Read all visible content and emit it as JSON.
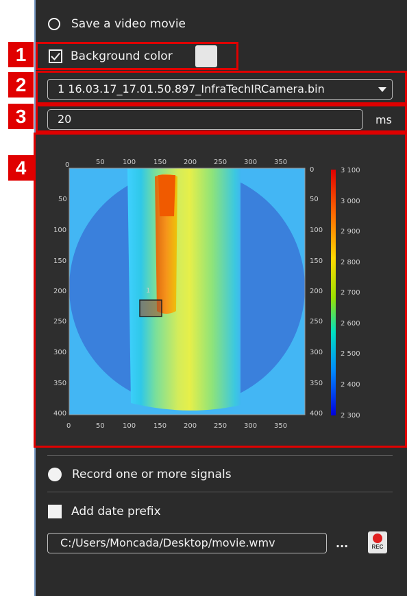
{
  "options": {
    "save_video_label": "Save a video movie",
    "background_color_label": "Background color",
    "file_dropdown_value": "1 16.03.17_17.01.50.897_InfraTechIRCamera.bin",
    "interval_value": "20",
    "interval_unit": "ms",
    "record_signals_label": "Record one or more signals",
    "add_date_prefix_label": "Add date prefix",
    "output_path": "C:/Users/Moncada/Desktop/movie.wmv",
    "browse_label": "...",
    "rec_label": "REC"
  },
  "annotations": [
    "1",
    "2",
    "3",
    "4"
  ],
  "thermal_image": {
    "x_ticks": [
      "0",
      "50",
      "100",
      "150",
      "200",
      "250",
      "300",
      "350"
    ],
    "y_ticks": [
      "0",
      "50",
      "100",
      "150",
      "200",
      "250",
      "300",
      "350",
      "400"
    ],
    "roi_label": "1",
    "colorbar_ticks": [
      "3 100",
      "3 000",
      "2 900",
      "2 800",
      "2 700",
      "2 600",
      "2 500",
      "2 400",
      "2 300"
    ]
  },
  "colors": {
    "panel_bg": "#2b2b2b",
    "annotation_red": "#e00000",
    "text": "#f2f2f2"
  }
}
